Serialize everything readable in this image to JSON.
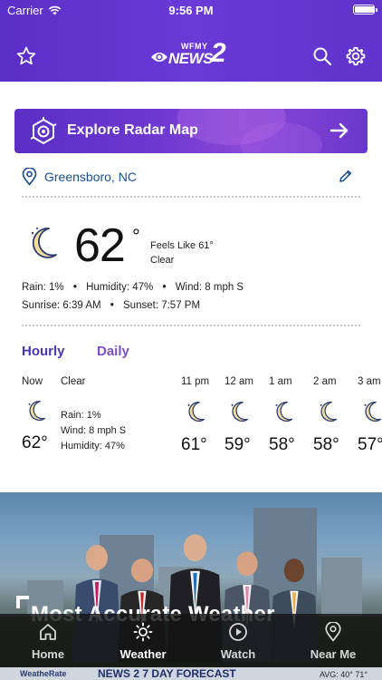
{
  "status_bar": {
    "carrier": "Carrier",
    "time": "9:56 PM",
    "battery_level": 0.95
  },
  "header": {
    "logo_small": "WFMY",
    "logo_news": "NEWS",
    "logo_number": "2"
  },
  "radar": {
    "label": "Explore Radar Map"
  },
  "location": {
    "name": "Greensboro, NC"
  },
  "current": {
    "temp": "62",
    "degree": "°",
    "feels_like": "Feels Like 61°",
    "condition": "Clear",
    "rain": "Rain: 1%",
    "humidity": "Humidity: 47%",
    "wind": "Wind: 8 mph S",
    "sunrise": "Sunrise: 6:39 AM",
    "sunset": "Sunset: 7:57 PM",
    "separator": "•"
  },
  "tabs": {
    "hourly": "Hourly",
    "daily": "Daily"
  },
  "now": {
    "label": "Now",
    "condition": "Clear",
    "temp": "62°",
    "rain": "Rain: 1%",
    "wind": "Wind: 8 mph S",
    "humidity": "Humidity: 47%"
  },
  "hourly": [
    {
      "time": "11 pm",
      "temp": "61°",
      "icon": "moon-icon"
    },
    {
      "time": "12 am",
      "temp": "59°",
      "icon": "moon-icon"
    },
    {
      "time": "1 am",
      "temp": "58°",
      "icon": "moon-icon"
    },
    {
      "time": "2 am",
      "temp": "58°",
      "icon": "moon-icon"
    },
    {
      "time": "3 am",
      "temp": "57°",
      "icon": "moon-icon"
    }
  ],
  "promo": {
    "title": "Most Accurate Weather",
    "badge": "WeatheRate",
    "strip_title": "NEWS 2  7 DAY FORECAST",
    "strip_avg": "AVG: 40° 71°"
  },
  "tabbar": {
    "items": [
      {
        "label": "Home",
        "icon": "home-icon"
      },
      {
        "label": "Weather",
        "icon": "sun-icon"
      },
      {
        "label": "Watch",
        "icon": "play-icon"
      },
      {
        "label": "Near Me",
        "icon": "location-pin-icon"
      }
    ],
    "active": "Weather"
  },
  "colors": {
    "header": "#5f33cc",
    "accent_blue": "#1d4f8f",
    "hourly_tab": "#4b35b4",
    "daily_tab": "#7b4fc7",
    "moon": "#f3dd9b"
  }
}
